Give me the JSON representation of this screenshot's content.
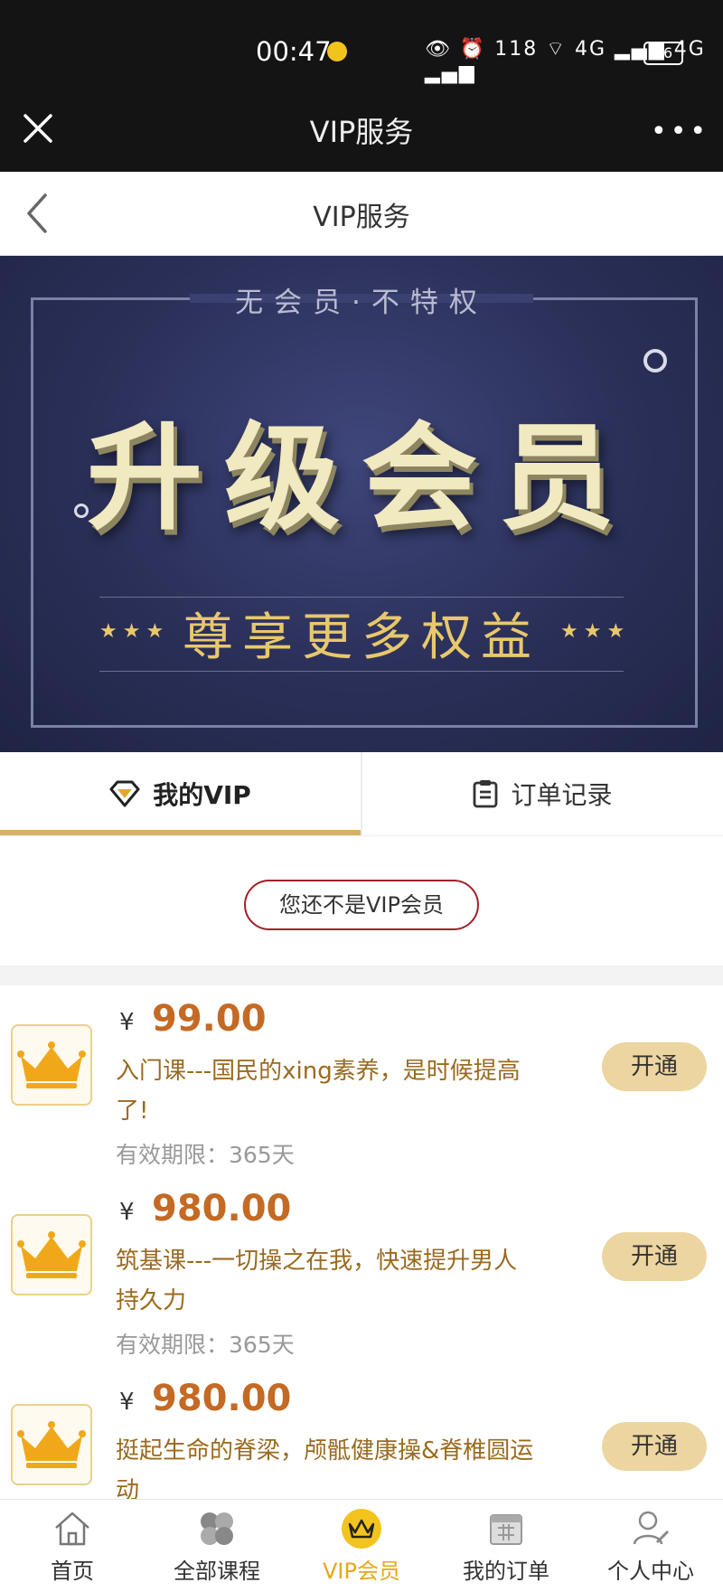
{
  "status_bar": {
    "time": "00:47",
    "net_speed": "118 K/s",
    "battery": "36",
    "icons": "👁 ⏰ 118 ⌔ 4G ▂▄▆ 4G ▂▄▆"
  },
  "title_bar": {
    "title": "VIP服务",
    "more": "•••"
  },
  "page_header": {
    "title": "VIP服务"
  },
  "banner": {
    "tagline": "无会员·不特权",
    "headline": "升级会员",
    "subline": "尊享更多权益",
    "stars": "★★★"
  },
  "tabs": [
    {
      "label": "我的VIP",
      "active": true
    },
    {
      "label": "订单记录",
      "active": false
    }
  ],
  "membership_status": "您还不是VIP会员",
  "plans": [
    {
      "currency": "¥",
      "price": "99.00",
      "title": "入门课---国民的xing素养，是时候提高了!",
      "validity": "有效期限：365天",
      "button": "开通"
    },
    {
      "currency": "¥",
      "price": "980.00",
      "title": "筑基课---一切操之在我，快速提升男人持久力",
      "validity": "有效期限：365天",
      "button": "开通"
    },
    {
      "currency": "¥",
      "price": "980.00",
      "title": "挺起生命的脊梁，颅骶健康操&脊椎圆运动",
      "validity": "",
      "button": "开通"
    }
  ],
  "bottom_nav": [
    {
      "label": "首页",
      "icon": "home-icon",
      "active": false
    },
    {
      "label": "全部课程",
      "icon": "clover-icon",
      "active": false
    },
    {
      "label": "VIP会员",
      "icon": "crown-icon",
      "active": true
    },
    {
      "label": "我的订单",
      "icon": "calendar-icon",
      "active": false
    },
    {
      "label": "个人中心",
      "icon": "person-icon",
      "active": false
    }
  ],
  "colors": {
    "accent": "#d9b066",
    "price": "#c46a24",
    "active_nav": "#e6a817",
    "button_bg": "#ecd5a0"
  }
}
